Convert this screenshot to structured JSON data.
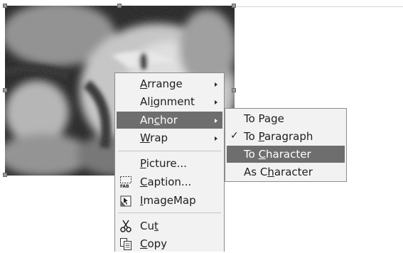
{
  "context_menu": {
    "items": [
      {
        "label": "Arrange",
        "mnemonic": "A",
        "submenu": true
      },
      {
        "label": "Alignment",
        "mnemonic": "i",
        "submenu": true
      },
      {
        "label": "Anchor",
        "mnemonic": "c",
        "submenu": true,
        "highlighted": true
      },
      {
        "label": "Wrap",
        "mnemonic": "W",
        "submenu": true
      },
      {
        "label": "Picture...",
        "mnemonic": "P",
        "submenu": false
      },
      {
        "label": "Caption...",
        "mnemonic": "C",
        "icon": "caption-icon",
        "submenu": false
      },
      {
        "label": "ImageMap",
        "mnemonic": "I",
        "icon": "imagemap-icon",
        "submenu": false
      },
      {
        "label": "Cut",
        "mnemonic": "t",
        "icon": "scissors-icon",
        "submenu": false
      },
      {
        "label": "Copy",
        "mnemonic": "C",
        "icon": "copy-icon",
        "submenu": false
      }
    ]
  },
  "anchor_submenu": {
    "items": [
      {
        "label": "To Page",
        "mnemonic": "g",
        "checked": false
      },
      {
        "label": "To Paragraph",
        "mnemonic": "P",
        "checked": true
      },
      {
        "label": "To Character",
        "mnemonic": "C",
        "checked": false,
        "highlighted": true
      },
      {
        "label": "As Character",
        "mnemonic": "h",
        "checked": false
      }
    ]
  },
  "colors": {
    "highlight": "#6e6e6e",
    "menu_bg": "#f2f2f2"
  }
}
